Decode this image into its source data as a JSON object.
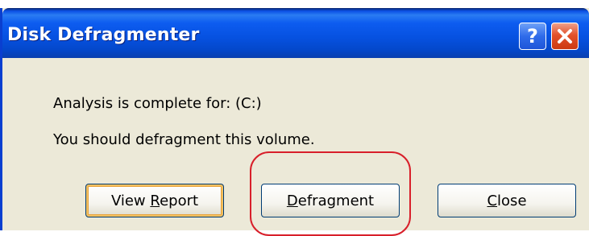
{
  "window": {
    "title": "Disk Defragmenter",
    "help_label": "?",
    "close_label": "✕"
  },
  "message": {
    "line1": "Analysis is complete for: (C:)",
    "line2": "You should defragment this volume."
  },
  "buttons": {
    "view_report": {
      "pre": "View ",
      "accel": "R",
      "post": "eport"
    },
    "defragment": {
      "pre": "",
      "accel": "D",
      "post": "efragment"
    },
    "close": {
      "pre": "",
      "accel": "C",
      "post": "lose"
    }
  },
  "colors": {
    "titlebar_blue": "#0651e0",
    "dialog_face": "#ece9d8",
    "close_button_red": "#e2512b",
    "highlight_ring": "#d81f2a"
  }
}
